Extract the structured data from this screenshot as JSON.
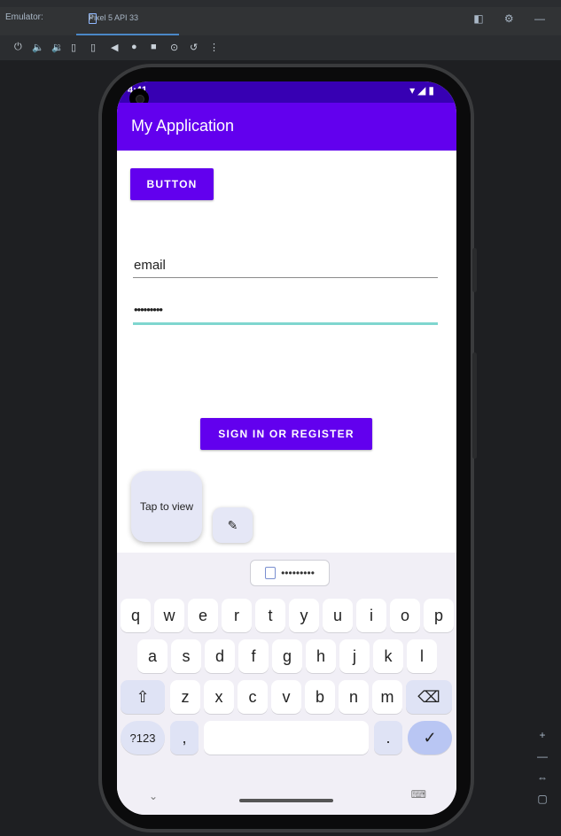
{
  "emulator": {
    "tab_label": "Emulator:",
    "device_tab": "Pixel 5 API 33",
    "close_glyph": "×",
    "top_right_icons": "◧ ⚙ —",
    "toolbar_icons": [
      "⏻",
      "🔈",
      "🔉",
      "▯",
      "▯",
      "◀",
      "●",
      "■",
      "⊙",
      "↺",
      "⋮"
    ],
    "zoom_controls": [
      "+",
      "—",
      "⇔",
      "▢"
    ]
  },
  "status_bar": {
    "time": "4:41",
    "right_icons": "▾◢▮"
  },
  "app": {
    "title": "My Application",
    "button_label": "BUTTON",
    "email_value": "email",
    "password_value": "•••••••••",
    "signin_label": "SIGN IN OR REGISTER"
  },
  "autofill_bubble": {
    "text": "Tap to view",
    "edit_icon": "✎"
  },
  "keyboard": {
    "suggestion_value": "•••••••••",
    "rows": [
      [
        "q",
        "w",
        "e",
        "r",
        "t",
        "y",
        "u",
        "i",
        "o",
        "p"
      ],
      [
        "a",
        "s",
        "d",
        "f",
        "g",
        "h",
        "j",
        "k",
        "l"
      ],
      [
        "⇧",
        "z",
        "x",
        "c",
        "v",
        "b",
        "n",
        "m",
        "⌫"
      ],
      [
        "?123",
        ",",
        "",
        ".",
        "✓"
      ]
    ],
    "nav_down": "⌄",
    "nav_keyboard": "⌨"
  },
  "colors": {
    "status_bar": "#3700b3",
    "app_bar": "#6200ee",
    "button": "#6200ee",
    "field_active": "#7fd6cf"
  }
}
